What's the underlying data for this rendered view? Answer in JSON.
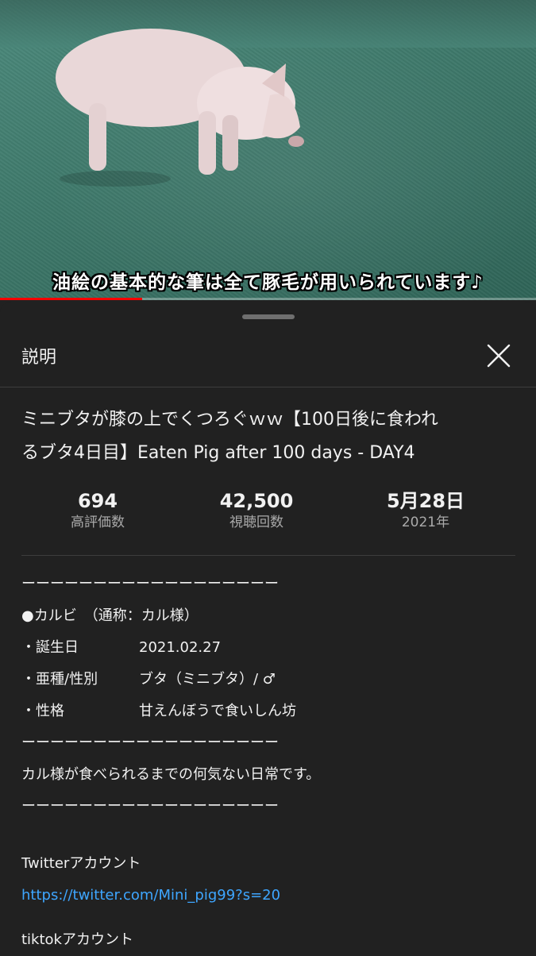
{
  "video": {
    "subtitle": "油絵の基本的な筆は全て豚毛が用いられています♪",
    "progress": 0.265
  },
  "panel": {
    "header_title": "説明"
  },
  "title": {
    "line1": "ミニブタが膝の上でくつろぐｗｗ【100日後に食われ",
    "line2_a": "るブタ4日目】",
    "line2_b": "Eaten Pig after 100 days - DAY4"
  },
  "stats": [
    {
      "value": "694",
      "label": "高評価数"
    },
    {
      "value": "42,500",
      "label": "視聴回数"
    },
    {
      "value": "5月28日",
      "label": "2021年"
    }
  ],
  "description": {
    "rule": "ーーーーーーーーーーーーーーーーーー",
    "name_line": "●カルビ　（通称：カル様）",
    "birthday_label": "・誕生日",
    "birthday_value": "2021.02.27",
    "species_label": "・亜種/性別",
    "species_value": "ブタ（ミニブタ）/ ♂",
    "personality_label": "・性格",
    "personality_value": "甘えんぼうで食いしん坊",
    "tagline": "カル様が食べられるまでの何気ない日常です。",
    "twitter_label": "Twitterアカウント",
    "twitter_url": "https://twitter.com/Mini_pig99?s=20",
    "tiktok_label": "tiktokアカウント"
  },
  "icons": {
    "close": "close-icon"
  },
  "colors": {
    "background": "#212121",
    "link": "#3ea6ff",
    "progress": "#ff0000",
    "secondary_text": "#aaaaaa"
  }
}
